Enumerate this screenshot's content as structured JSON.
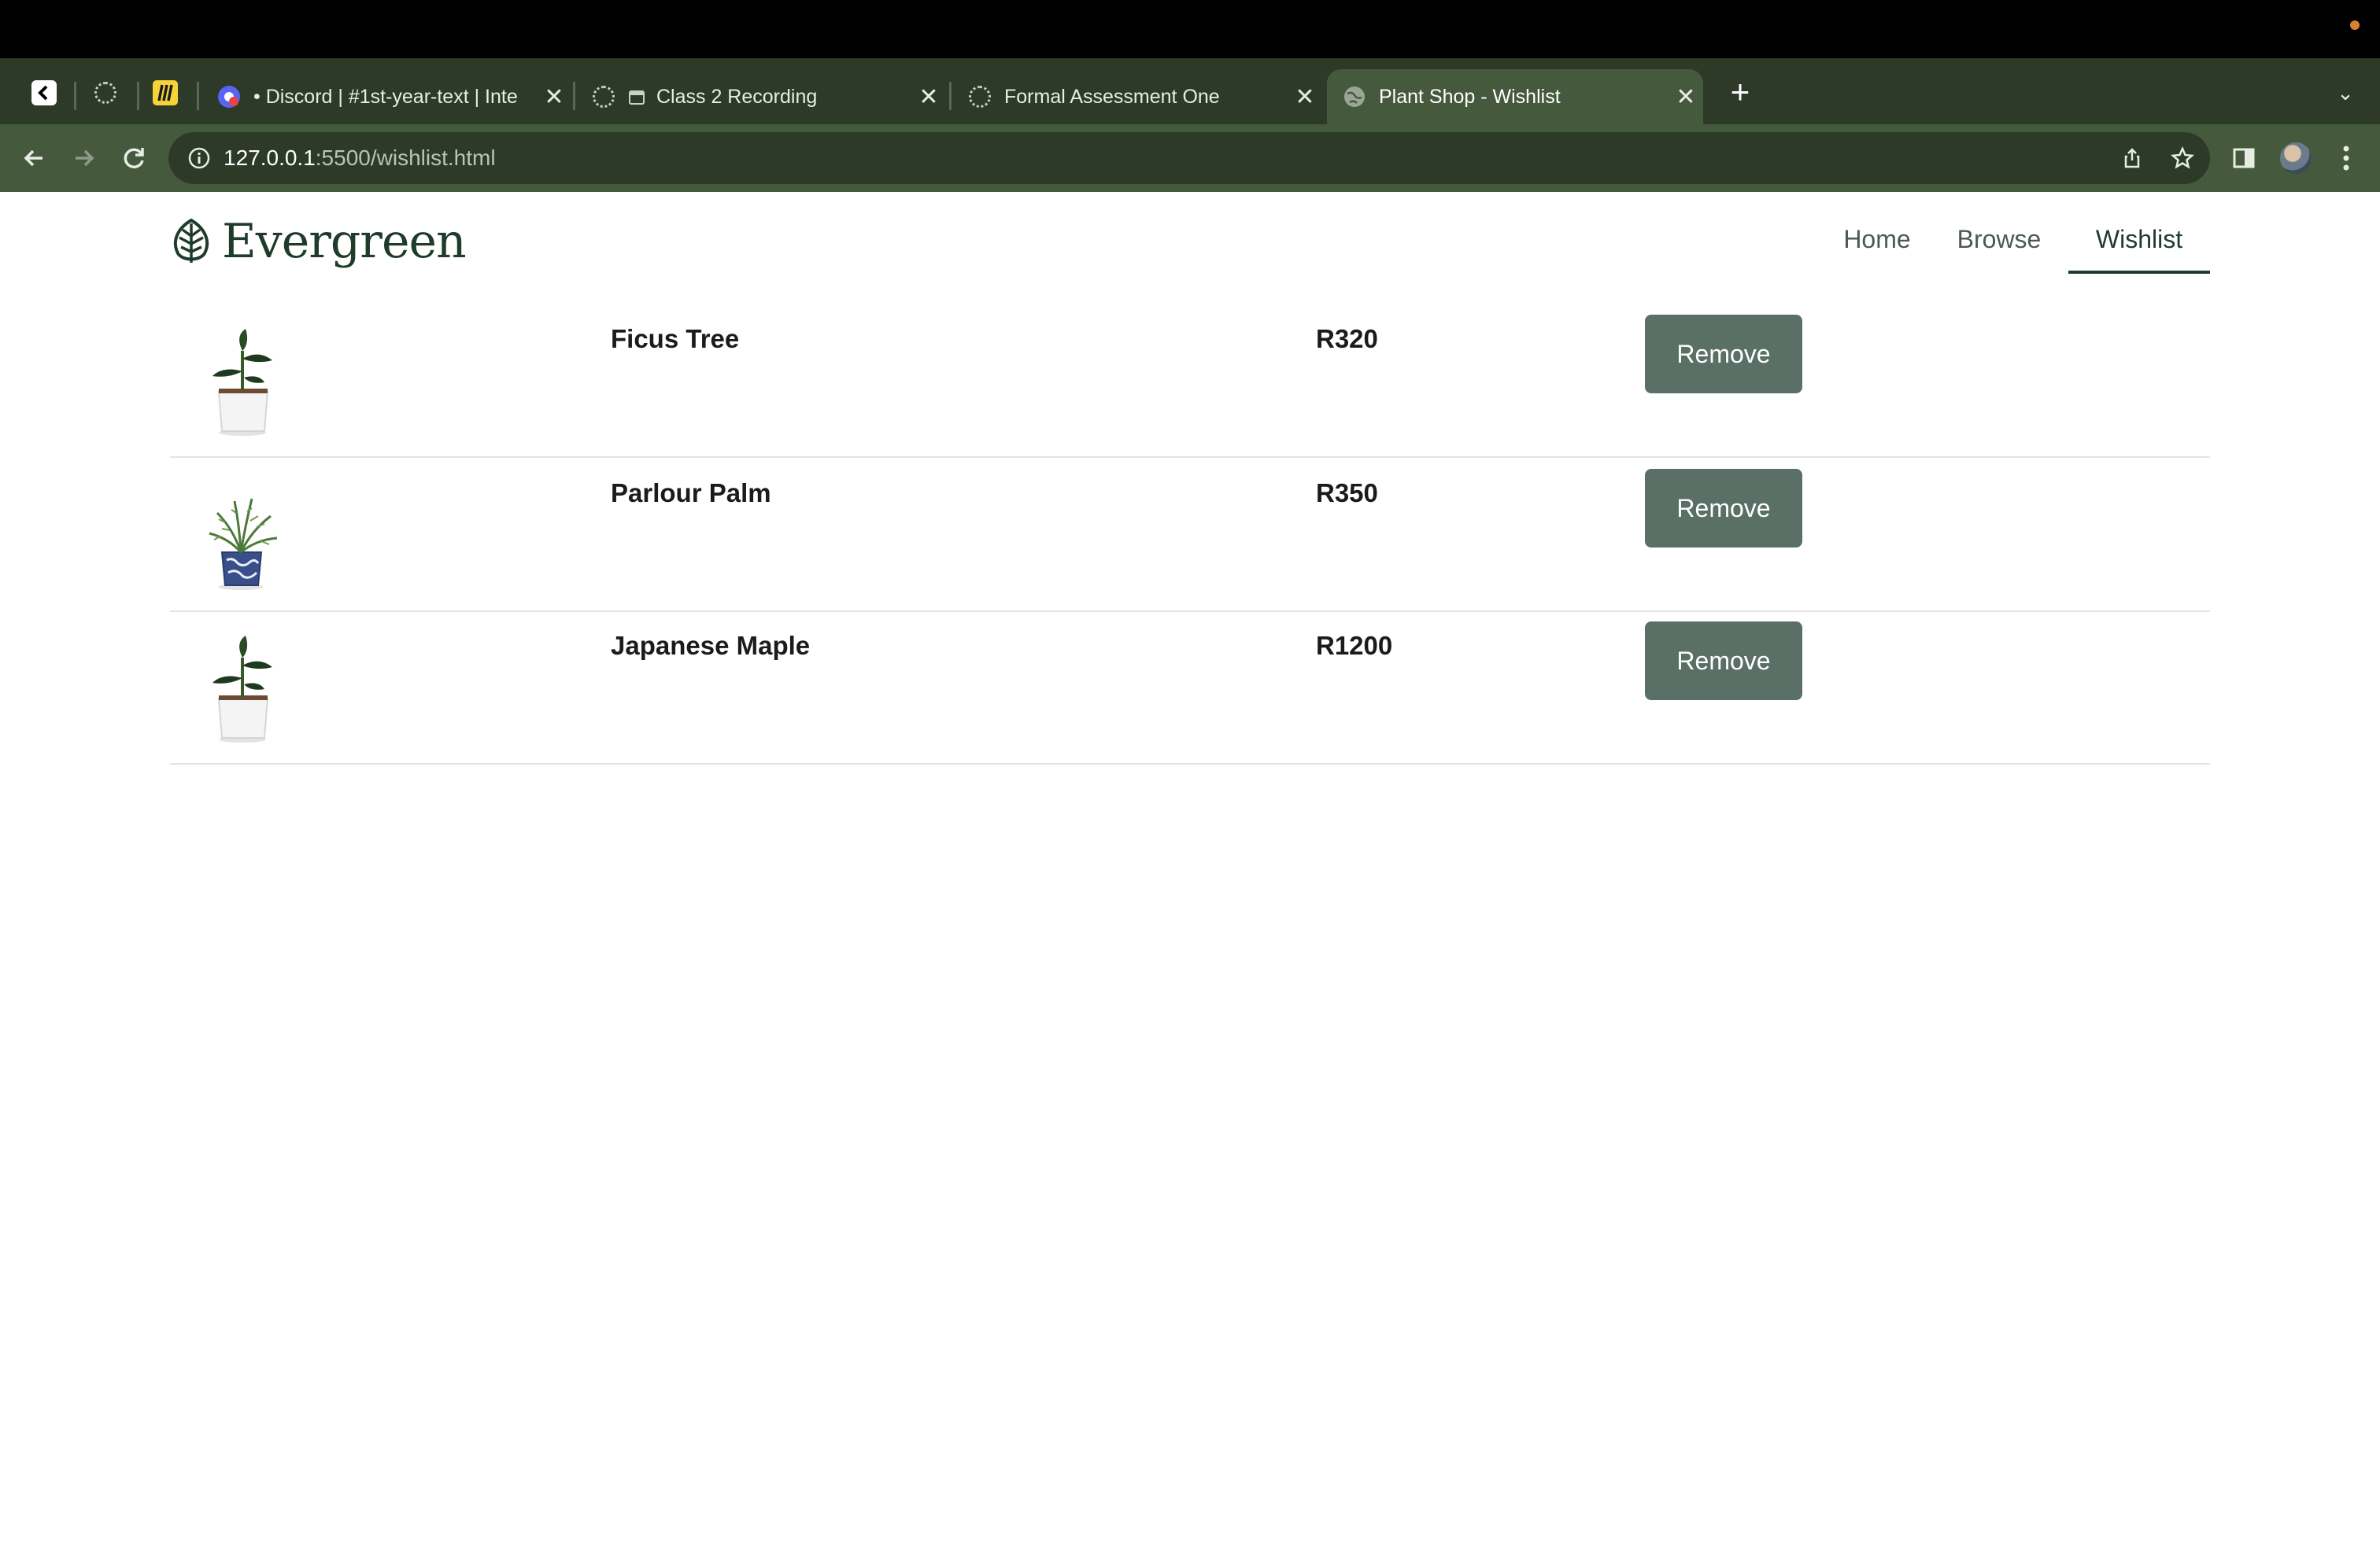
{
  "browser": {
    "tabs": [
      {
        "title": "",
        "icon": "back-arrow-favicon-icon"
      },
      {
        "title": "",
        "icon": "loading-spinner-icon"
      },
      {
        "title": "",
        "icon": "miro-favicon-icon"
      },
      {
        "title": "• Discord | #1st-year-text | Inte",
        "icon": "discord-favicon-icon"
      },
      {
        "title": "Class 2 Recording",
        "icon": "loading-spinner-icon"
      },
      {
        "title": "Formal Assessment One",
        "icon": "loading-spinner-icon"
      },
      {
        "title": "Plant Shop - Wishlist",
        "icon": "globe-icon",
        "active": true
      }
    ],
    "address": {
      "host": "127.0.0.1",
      "path": ":5500/wishlist.html"
    }
  },
  "site": {
    "brand": "Evergreen",
    "nav": [
      {
        "label": "Home"
      },
      {
        "label": "Browse"
      },
      {
        "label": "Wishlist",
        "active": true
      }
    ],
    "accent_color": "#1f3b2c",
    "button_color": "#5a7066"
  },
  "wishlist": [
    {
      "name": "Ficus Tree",
      "price": "R320",
      "action": "Remove",
      "image": "ficus-plant-image"
    },
    {
      "name": "Parlour Palm",
      "price": "R350",
      "action": "Remove",
      "image": "parlour-palm-image"
    },
    {
      "name": "Japanese Maple",
      "price": "R1200",
      "action": "Remove",
      "image": "ficus-plant-image"
    }
  ]
}
